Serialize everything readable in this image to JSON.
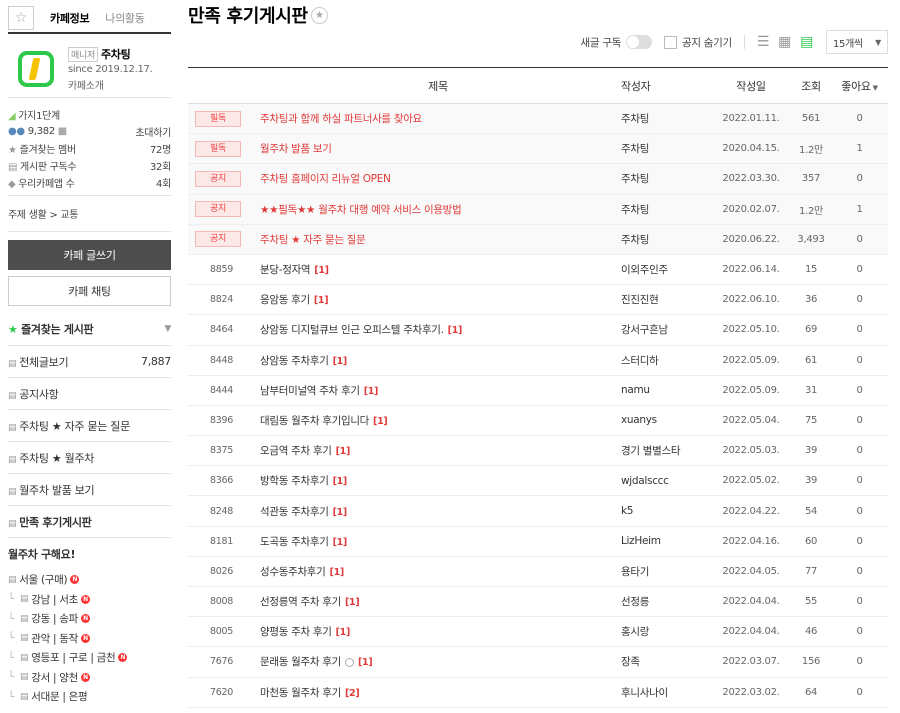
{
  "sidebar": {
    "tabs": {
      "cafe_info": "카페정보",
      "my_activity": "나의활동"
    },
    "profile": {
      "manager_badge": "매니저",
      "name": "주차팅",
      "since": "since 2019.12.17.",
      "intro": "카페소개"
    },
    "stats": {
      "level": "가지1단계",
      "members": "9,382",
      "invite": "초대하기",
      "fav_members_label": "즐겨찾는 멤버",
      "fav_members_value": "72명",
      "board_subs_label": "게시판 구독수",
      "board_subs_value": "32회",
      "our_cafe_app_label": "우리카페앱 수",
      "our_cafe_app_value": "4회"
    },
    "topic": "주제 생활 > 교통",
    "write_button": "카페 글쓰기",
    "chat_button": "카페 채팅",
    "fav_boards_title": "즐겨찾는 게시판",
    "menu": [
      {
        "label": "전체글보기",
        "count": "7,887"
      },
      {
        "label": "공지사항",
        "count": ""
      },
      {
        "label": "주차팅 ★ 자주 묻는 질문",
        "count": ""
      },
      {
        "label": "주차팅 ★ 월주차",
        "count": ""
      },
      {
        "label": "월주차 발품 보기",
        "count": ""
      },
      {
        "label": "만족 후기게시판",
        "count": ""
      }
    ],
    "group_title": "월주차 구해요!",
    "group_items": [
      {
        "label": "서울 (구매)",
        "new": "N"
      },
      {
        "label": "강남 | 서초",
        "new": "N"
      },
      {
        "label": "강동 | 송파",
        "new": "N"
      },
      {
        "label": "관악 | 동작",
        "new": "N"
      },
      {
        "label": "영등포 | 구로 | 금천",
        "new": "N"
      },
      {
        "label": "강서 | 양천",
        "new": "N"
      },
      {
        "label": "서대문 | 은평",
        "new": ""
      }
    ]
  },
  "main": {
    "title": "만족 후기게시판",
    "toolbar": {
      "new_post_sub": "새글 구독",
      "hide_notice": "공지 숨기기",
      "per_page": "15개씩"
    },
    "columns": {
      "title": "제목",
      "author": "작성자",
      "date": "작성일",
      "views": "조회",
      "likes": "좋아요"
    },
    "notices": [
      {
        "tag": "필독",
        "title": "주차팅과 함께 하실 파트너사를 찾아요",
        "author": "주차팅",
        "date": "2022.01.11.",
        "views": "561",
        "likes": "0"
      },
      {
        "tag": "필독",
        "title": "월주차 발품 보기",
        "author": "주차팅",
        "date": "2020.04.15.",
        "views": "1.2만",
        "likes": "1"
      },
      {
        "tag": "공지",
        "title": "주차팅 홈페이지 리뉴얼 OPEN",
        "author": "주차팅",
        "date": "2022.03.30.",
        "views": "357",
        "likes": "0"
      },
      {
        "tag": "공지",
        "title": "★★필독★★ 월주차 대행 예약 서비스 이용방법",
        "author": "주차팅",
        "date": "2020.02.07.",
        "views": "1.2만",
        "likes": "1"
      },
      {
        "tag": "공지",
        "title": "주차팅 ★ 자주 묻는 질문",
        "author": "주차팅",
        "date": "2020.06.22.",
        "views": "3,493",
        "likes": "0"
      }
    ],
    "posts": [
      {
        "no": "8859",
        "title": "분당-정자역",
        "comments": "[1]",
        "author": "이외주인주",
        "date": "2022.06.14.",
        "views": "15",
        "likes": "0"
      },
      {
        "no": "8824",
        "title": "응암동 후기",
        "comments": "[1]",
        "author": "진진진현",
        "date": "2022.06.10.",
        "views": "36",
        "likes": "0"
      },
      {
        "no": "8464",
        "title": "상암동 디지털큐브 인근 오피스텔 주차후기.",
        "comments": "[1]",
        "author": "강서구흔남",
        "date": "2022.05.10.",
        "views": "69",
        "likes": "0"
      },
      {
        "no": "8448",
        "title": "상암동 주차후기",
        "comments": "[1]",
        "author": "스터디하",
        "date": "2022.05.09.",
        "views": "61",
        "likes": "0"
      },
      {
        "no": "8444",
        "title": "남부터미널역 주차 후기",
        "comments": "[1]",
        "author": "namu",
        "date": "2022.05.09.",
        "views": "31",
        "likes": "0"
      },
      {
        "no": "8396",
        "title": "대림동 월주차 후기입니다",
        "comments": "[1]",
        "author": "xuanys",
        "date": "2022.05.04.",
        "views": "75",
        "likes": "0"
      },
      {
        "no": "8375",
        "title": "오금역 주차 후기",
        "comments": "[1]",
        "author": "경기 별별스타",
        "date": "2022.05.03.",
        "views": "39",
        "likes": "0"
      },
      {
        "no": "8366",
        "title": "방학동 주차후기",
        "comments": "[1]",
        "author": "wjdalsccc",
        "date": "2022.05.02.",
        "views": "39",
        "likes": "0"
      },
      {
        "no": "8248",
        "title": "석관동 주차후기",
        "comments": "[1]",
        "author": "k5",
        "date": "2022.04.22.",
        "views": "54",
        "likes": "0"
      },
      {
        "no": "8181",
        "title": "도곡동 주차후기",
        "comments": "[1]",
        "author": "LizHeim",
        "date": "2022.04.16.",
        "views": "60",
        "likes": "0"
      },
      {
        "no": "8026",
        "title": "성수동주차후기",
        "comments": "[1]",
        "author": "용타기",
        "date": "2022.04.05.",
        "views": "77",
        "likes": "0"
      },
      {
        "no": "8008",
        "title": "선정릉역 주차 후기",
        "comments": "[1]",
        "author": "선정릉",
        "date": "2022.04.04.",
        "views": "55",
        "likes": "0"
      },
      {
        "no": "8005",
        "title": "양평동 주차 후기",
        "comments": "[1]",
        "author": "홍시랑",
        "date": "2022.04.04.",
        "views": "46",
        "likes": "0"
      },
      {
        "no": "7676",
        "title": "문래동 월주차 후기",
        "comments": "[1]",
        "author": "장족",
        "date": "2022.03.07.",
        "views": "156",
        "likes": "0",
        "has_image": true
      },
      {
        "no": "7620",
        "title": "마천동 월주차 후기",
        "comments": "[2]",
        "author": "후니사나이",
        "date": "2022.03.02.",
        "views": "64",
        "likes": "0"
      }
    ]
  }
}
